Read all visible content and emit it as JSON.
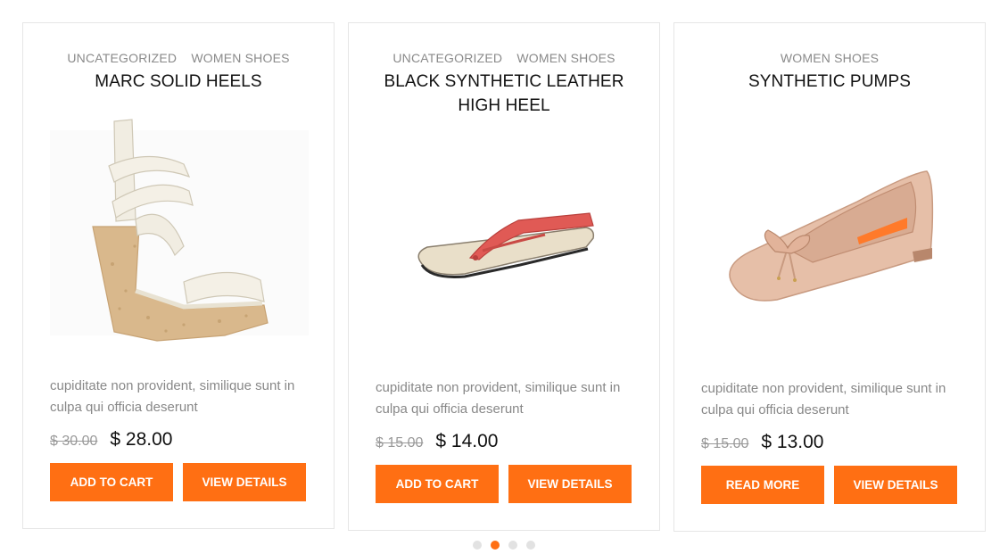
{
  "products": [
    {
      "categories": [
        "UNCATEGORIZED",
        "WOMEN SHOES"
      ],
      "title": "MARC SOLID HEELS",
      "image": "white-cork-wedge-sandal",
      "description": "cupiditate non provident, similique sunt in culpa qui officia deserunt",
      "old_price": "$ 30.00",
      "price": "$ 28.00",
      "primary_button": "ADD TO CART",
      "secondary_button": "VIEW DETAILS"
    },
    {
      "categories": [
        "UNCATEGORIZED",
        "WOMEN SHOES"
      ],
      "title": "BLACK SYNTHETIC LEATHER HIGH HEEL",
      "image": "red-flip-flop",
      "description": "cupiditate non provident, similique sunt in culpa qui officia deserunt",
      "old_price": "$ 15.00",
      "price": "$ 14.00",
      "primary_button": "ADD TO CART",
      "secondary_button": "VIEW DETAILS"
    },
    {
      "categories": [
        "WOMEN SHOES"
      ],
      "title": "SYNTHETIC PUMPS",
      "image": "nude-ballet-flat",
      "description": "cupiditate non provident, similique sunt in culpa qui officia deserunt",
      "old_price": "$ 15.00",
      "price": "$ 13.00",
      "primary_button": "READ MORE",
      "secondary_button": "VIEW DETAILS"
    }
  ],
  "carousel": {
    "pages": 4,
    "active_page": 2
  },
  "colors": {
    "accent": "#ff6f13",
    "border": "#e6e6e6",
    "muted_text": "#888888"
  }
}
